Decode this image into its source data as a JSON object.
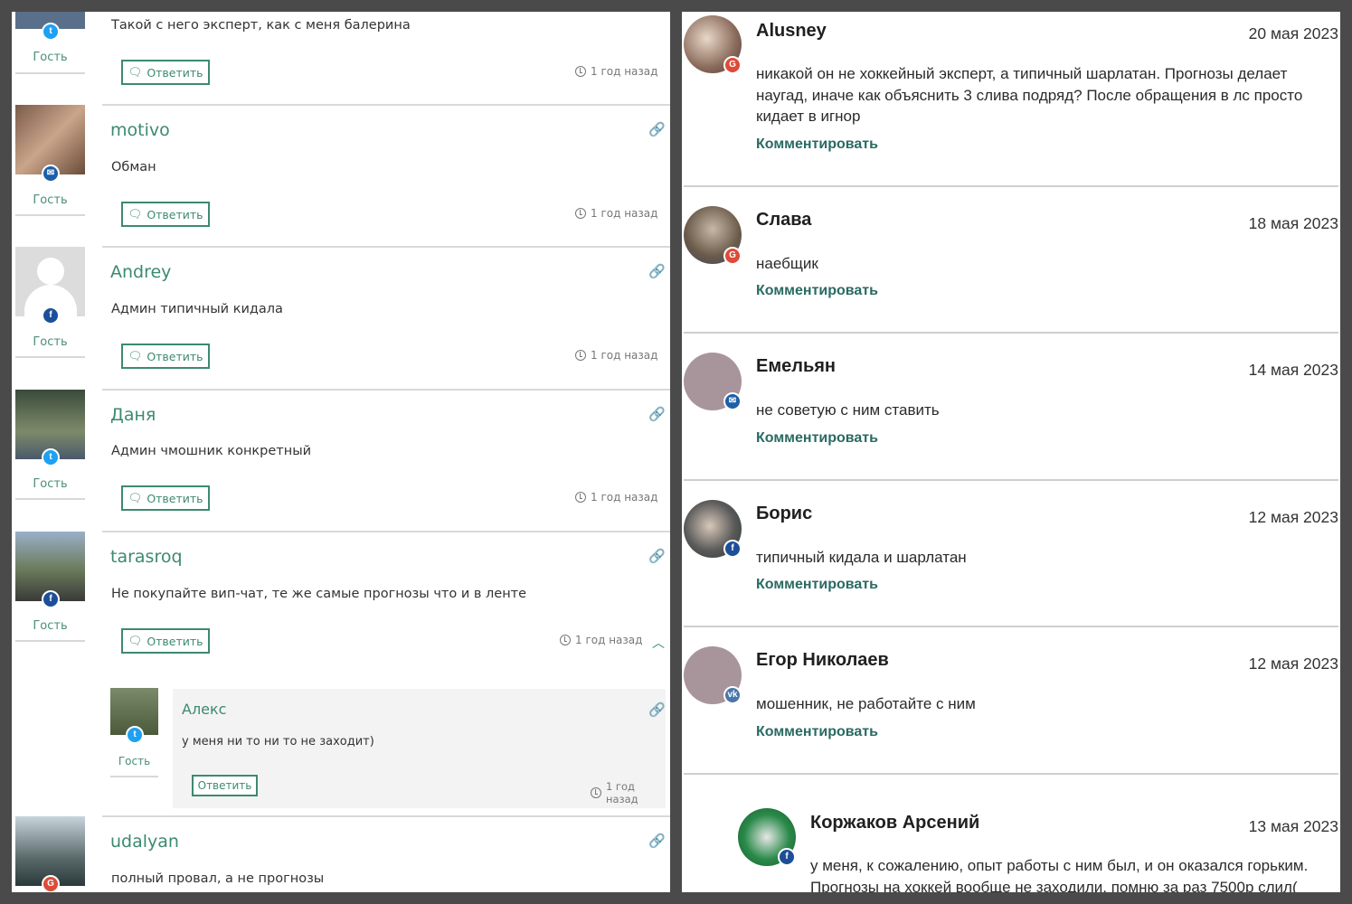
{
  "left_panel": {
    "guest_label": "Гость",
    "reply_label": "Ответить",
    "top_fragment": {
      "text": "Такой с него эксперт, как с меня балерина",
      "time": "1 год назад"
    },
    "comments": [
      {
        "name": "motivo",
        "text": "Обман",
        "time": "1 год назад",
        "badge": "mail-icon"
      },
      {
        "name": "Andrey",
        "text": "Админ типичный кидала",
        "time": "1 год назад",
        "badge": "facebook-icon"
      },
      {
        "name": "Даня",
        "text": "Админ чмошник конкретный",
        "time": "1 год назад",
        "badge": "twitter-icon"
      },
      {
        "name": "tarasroq",
        "text": "Не покупайте вип-чат, те же самые прогнозы что и в ленте",
        "time": "1 год назад",
        "badge": "facebook-icon"
      }
    ],
    "reply": {
      "name": "Алекс",
      "text": "у меня ни то ни то не заходит)",
      "time": "1 год назад",
      "badge": "twitter-icon"
    },
    "bottom_fragment": {
      "name": "udalyan",
      "text": "полный провал, а не прогнозы",
      "badge": "google-plus-icon"
    }
  },
  "right_panel": {
    "comment_label": "Комментировать",
    "comments": [
      {
        "name": "Alusney",
        "date": "20 мая 2023",
        "text": "никакой он не хоккейный эксперт, а типичный шарлатан. Прогнозы делает наугад, иначе как объяснить 3 слива подряд? После обращения в лс просто кидает в игнор",
        "badge": "google-plus-icon"
      },
      {
        "name": "Слава",
        "date": "18 мая 2023",
        "text": "наебщик",
        "badge": "google-plus-icon"
      },
      {
        "name": "Емельян",
        "date": "14 мая 2023",
        "text": "не советую с ним ставить",
        "badge": "mail-icon"
      },
      {
        "name": "Борис",
        "date": "12 мая 2023",
        "text": "типичный кидала и шарлатан",
        "badge": "facebook-icon"
      },
      {
        "name": "Егор Николаев",
        "date": "12 мая 2023",
        "text": "мошенник, не работайте с ним",
        "badge": "vk-icon"
      }
    ],
    "nested": {
      "name": "Коржаков Арсений",
      "date": "13 мая 2023",
      "text": "у меня, к сожалению, опыт работы с ним был, и он оказался горьким. Прогнозы на хоккей вообще не заходили, помню за раз 7500р слил(",
      "badge": "facebook-icon"
    }
  },
  "colors": {
    "accent_green": "#3c8a70",
    "comment_link": "#2a6a63",
    "twitter": "#1da1f2",
    "facebook": "#1d4e9a",
    "google_plus": "#dd4b39",
    "vk": "#4a76a8"
  }
}
